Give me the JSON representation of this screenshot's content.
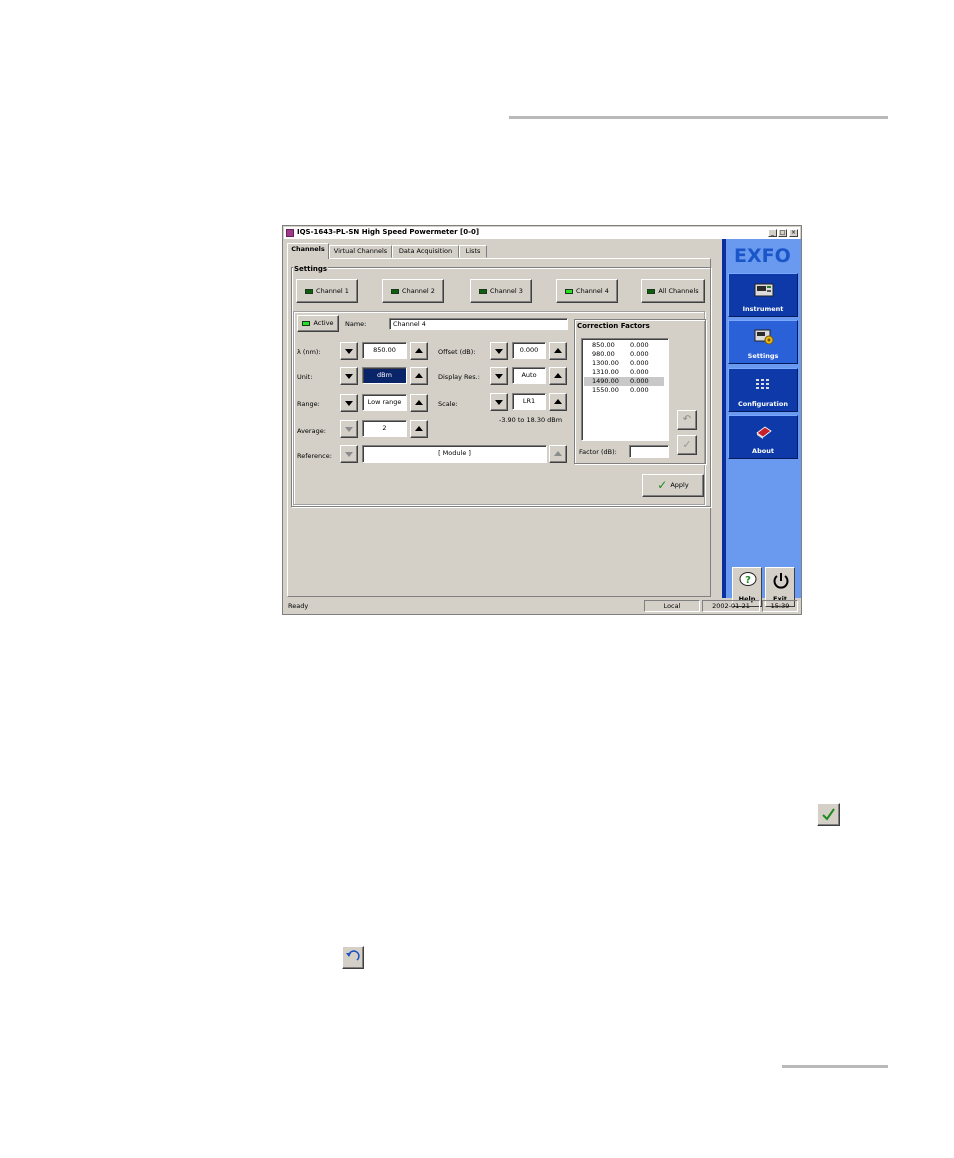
{
  "window": {
    "title": "IQS-1643-PL-SN High Speed Powermeter [0-0]",
    "minimize": "_",
    "maximize": "□",
    "close": "×"
  },
  "tabs": [
    {
      "label": "Channels",
      "active": true
    },
    {
      "label": "Virtual Channels",
      "active": false
    },
    {
      "label": "Data Acquisition",
      "active": false
    },
    {
      "label": "Lists",
      "active": false
    }
  ],
  "settings": {
    "group_label": "Settings",
    "channels": [
      {
        "label": "Channel 1",
        "on": false
      },
      {
        "label": "Channel 2",
        "on": false
      },
      {
        "label": "Channel 3",
        "on": false
      },
      {
        "label": "Channel 4",
        "on": true
      },
      {
        "label": "All Channels",
        "on": false
      }
    ],
    "active_label": "Active",
    "name_label": "Name:",
    "name_value": "Channel 4",
    "wavelength_label": "λ (nm):",
    "wavelength_value": "850.00",
    "unit_label": "Unit:",
    "unit_value": "dBm",
    "range_label": "Range:",
    "range_value": "Low range",
    "average_label": "Average:",
    "average_value": "2",
    "reference_label": "Reference:",
    "reference_value": "[ Module ]",
    "offset_label": "Offset (dB):",
    "offset_value": "0.000",
    "display_res_label": "Display Res.:",
    "display_res_value": "Auto",
    "scale_label": "Scale:",
    "scale_value": "LR1",
    "scale_range": "-3.90 to 18.30 dBm"
  },
  "correction": {
    "group_label": "Correction Factors",
    "rows": [
      {
        "wl": "850.00",
        "factor": "0.000",
        "highlight": false
      },
      {
        "wl": "980.00",
        "factor": "0.000",
        "highlight": false
      },
      {
        "wl": "1300.00",
        "factor": "0.000",
        "highlight": false
      },
      {
        "wl": "1310.00",
        "factor": "0.000",
        "highlight": false
      },
      {
        "wl": "1490.00",
        "factor": "0.000",
        "highlight": true
      },
      {
        "wl": "1550.00",
        "factor": "0.000",
        "highlight": false
      }
    ],
    "factor_label": "Factor (dB):",
    "factor_value": ""
  },
  "apply_label": "Apply",
  "side": {
    "logo": "EXFO",
    "buttons": [
      {
        "label": "Instrument",
        "selected": false
      },
      {
        "label": "Settings",
        "selected": true
      },
      {
        "label": "Configuration",
        "selected": false
      },
      {
        "label": "About",
        "selected": false
      }
    ],
    "help_label": "Help",
    "exit_label": "Exit"
  },
  "status": {
    "state": "Ready",
    "mode": "Local",
    "date": "2002-01-21",
    "time": "15:39"
  },
  "colors": {
    "accent_blue": "#0d3aa8",
    "side_panel": "#6a9af0",
    "led_on": "#28e028",
    "led_off": "#0e5e10",
    "check_green": "#1e8a1e"
  }
}
